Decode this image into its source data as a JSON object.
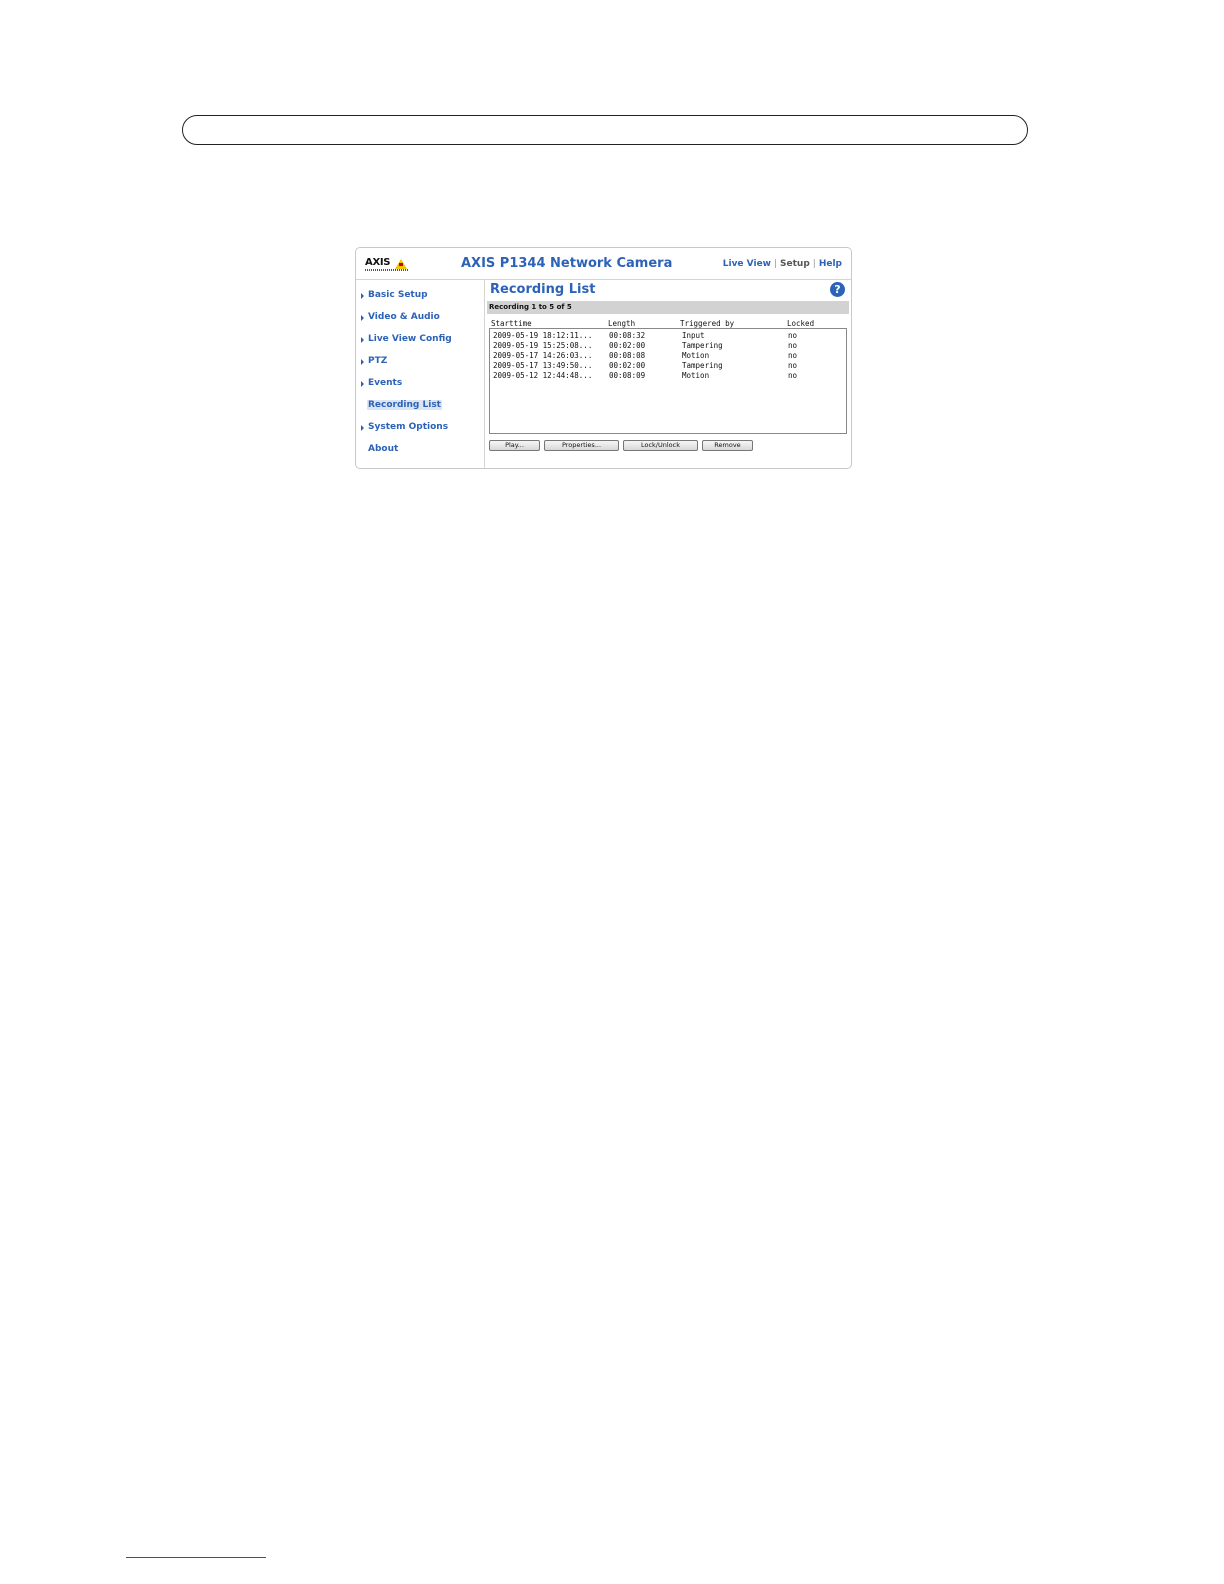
{
  "header": {
    "product_title": "AXIS P1344 Network Camera",
    "logo_text": "AXIS"
  },
  "topnav": {
    "live_view": "Live View",
    "setup": "Setup",
    "help": "Help",
    "separator": "|"
  },
  "sidebar": {
    "items": [
      {
        "label": "Basic Setup",
        "has_arrow": true
      },
      {
        "label": "Video & Audio",
        "has_arrow": true
      },
      {
        "label": "Live View Config",
        "has_arrow": true
      },
      {
        "label": "PTZ",
        "has_arrow": true
      },
      {
        "label": "Events",
        "has_arrow": true
      },
      {
        "label": "Recording List",
        "has_arrow": false,
        "active": true
      },
      {
        "label": "System Options",
        "has_arrow": true
      },
      {
        "label": "About",
        "has_arrow": false
      }
    ]
  },
  "main": {
    "title": "Recording List",
    "help_glyph": "?",
    "count_text": "Recording 1 to 5 of 5",
    "columns": [
      "Starttime",
      "Length",
      "Triggered by",
      "Locked"
    ],
    "rows": [
      [
        "2009-05-19 18:12:11...",
        "00:08:32",
        "Input",
        "no"
      ],
      [
        "2009-05-19 15:25:08...",
        "00:02:00",
        "Tampering",
        "no"
      ],
      [
        "2009-05-17 14:26:03...",
        "00:08:08",
        "Motion",
        "no"
      ],
      [
        "2009-05-17 13:49:50...",
        "00:02:00",
        "Tampering",
        "no"
      ],
      [
        "2009-05-12 12:44:48...",
        "00:08:09",
        "Motion",
        "no"
      ]
    ],
    "buttons": {
      "play": "Play...",
      "properties": "Properties...",
      "lock": "Lock/Unlock",
      "remove": "Remove"
    }
  },
  "colors": {
    "accent": "#2c63b8",
    "count_bar": "#d2d2d2",
    "active_bg": "#dbe4f1"
  }
}
